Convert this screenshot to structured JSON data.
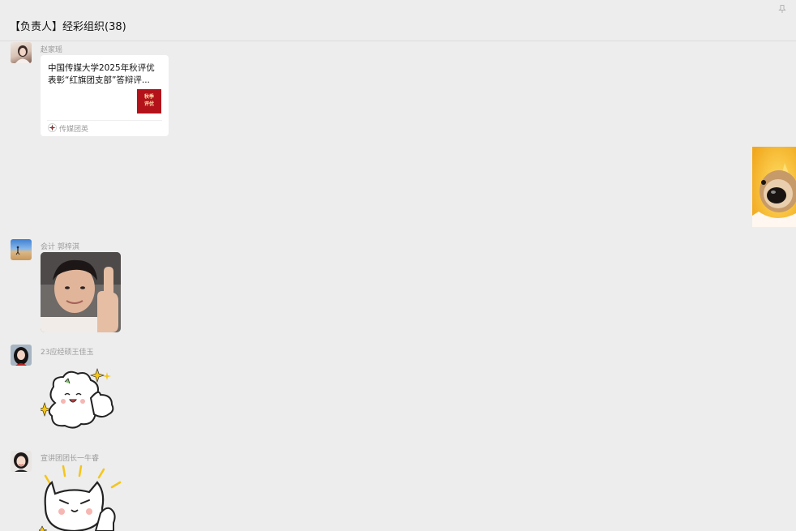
{
  "chat": {
    "title": "【负责人】经彩组织(38)"
  },
  "messages": [
    {
      "sender": "赵家瑶",
      "link_card": {
        "title": "中国传媒大学2025年秋评优表彰“红旗团支部”答辩评...",
        "thumb_text": [
          "秋季",
          "评优"
        ],
        "source": "传媒团英"
      }
    },
    {
      "sender": "会计 郭梓淇",
      "type": "image",
      "content": "thumbs-up-photo"
    },
    {
      "sender": "23应经硕王佳玉",
      "type": "sticker",
      "content": "sheep-thumbs-up-sticker"
    },
    {
      "sender": "宣讲团团长一牛睿",
      "type": "sticker",
      "content": "cat-thumbs-up-sticker"
    }
  ],
  "self_message": {
    "type": "sticker",
    "content": "dog-face-sticker"
  },
  "colors": {
    "background": "#ededed",
    "card": "#ffffff",
    "sender": "#9a9a9a",
    "thumb_red": "#b3121b"
  }
}
